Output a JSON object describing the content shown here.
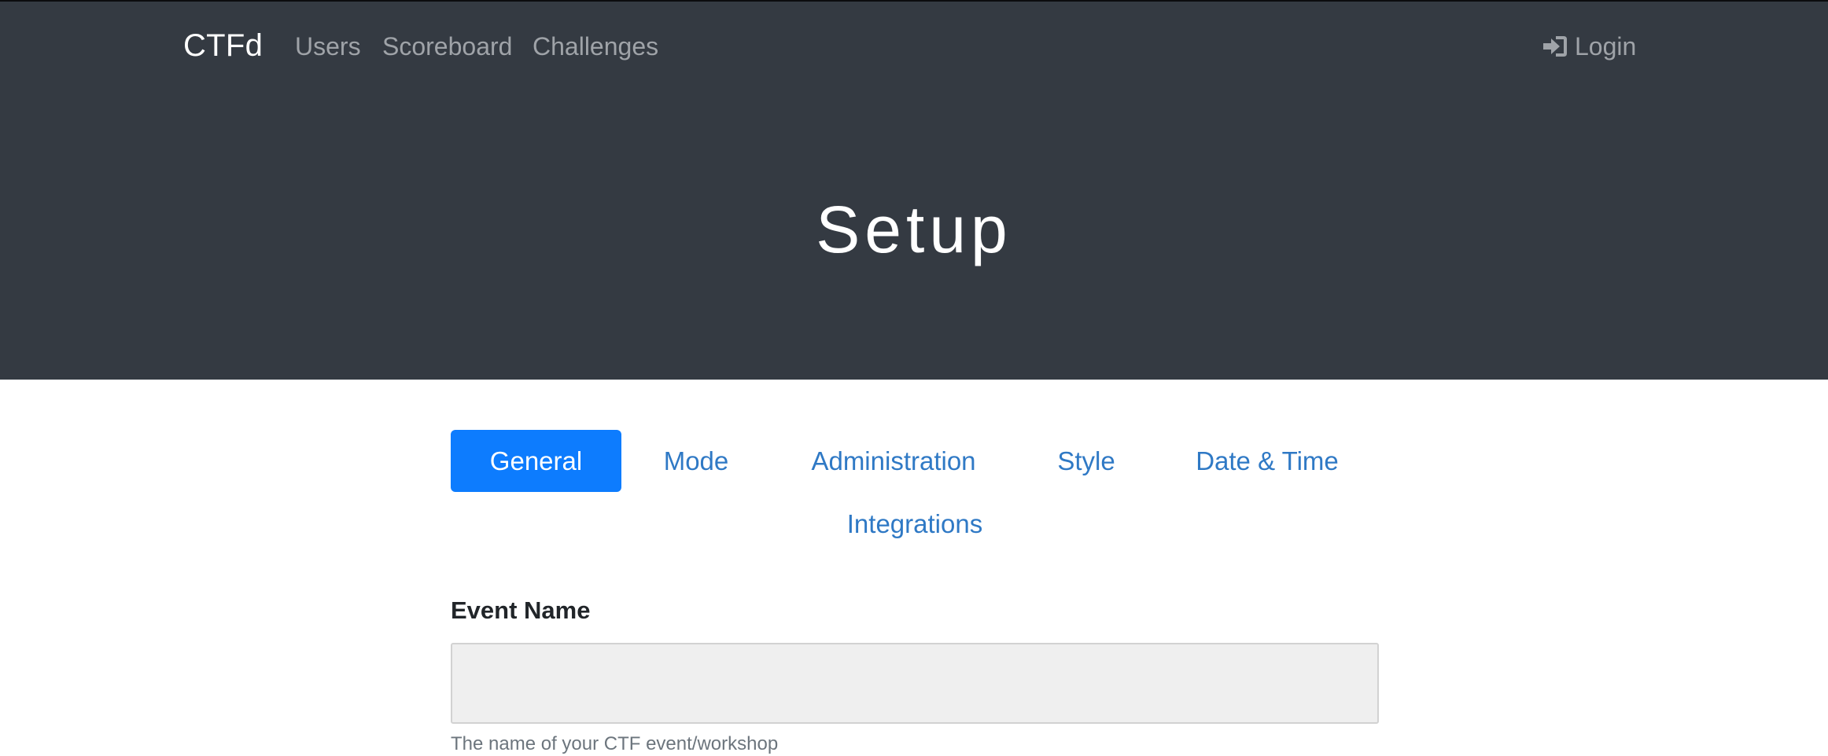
{
  "navbar": {
    "brand": "CTFd",
    "links": [
      "Users",
      "Scoreboard",
      "Challenges"
    ],
    "login": {
      "label": "Login",
      "icon": "sign-in-icon"
    }
  },
  "hero": {
    "title": "Setup"
  },
  "tabs": [
    {
      "label": "General",
      "active": true
    },
    {
      "label": "Mode",
      "active": false
    },
    {
      "label": "Administration",
      "active": false
    },
    {
      "label": "Style",
      "active": false
    },
    {
      "label": "Date & Time",
      "active": false
    },
    {
      "label": "Integrations",
      "active": false
    }
  ],
  "form": {
    "event_name": {
      "label": "Event Name",
      "value": "",
      "help": "The name of your CTF event/workshop"
    }
  },
  "colors": {
    "hero_bg": "#343a42",
    "accent": "#0d7cfe",
    "tab_link": "#2f79c5"
  }
}
